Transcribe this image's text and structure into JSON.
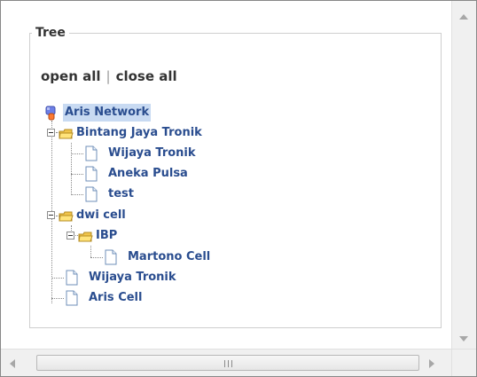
{
  "tree_panel": {
    "legend": "Tree"
  },
  "controls": {
    "open_all": "open all",
    "separator": "|",
    "close_all": "close all"
  },
  "tree": {
    "root": {
      "label": "Aris Network",
      "icon": "network-icon"
    },
    "nodes": [
      {
        "label": "Bintang Jaya Tronik",
        "icon": "folder-open-icon",
        "toggle": "minus"
      },
      {
        "label": "Wijaya Tronik",
        "icon": "page-icon"
      },
      {
        "label": "Aneka Pulsa",
        "icon": "page-icon"
      },
      {
        "label": "test",
        "icon": "page-icon"
      },
      {
        "label": "dwi cell",
        "icon": "folder-open-icon",
        "toggle": "minus"
      },
      {
        "label": "IBP",
        "icon": "folder-open-icon",
        "toggle": "minus"
      },
      {
        "label": "Martono Cell",
        "icon": "page-icon"
      },
      {
        "label": "Wijaya Tronik",
        "icon": "page-icon"
      },
      {
        "label": "Aris Cell",
        "icon": "page-icon"
      }
    ]
  },
  "scrollbars": {
    "horizontal_thumb_grip": "III"
  },
  "colors": {
    "link": "#2a4d8f",
    "root_highlight": "#c8daf2",
    "folder": "#f0c44a",
    "page_border": "#6f8fb8"
  }
}
